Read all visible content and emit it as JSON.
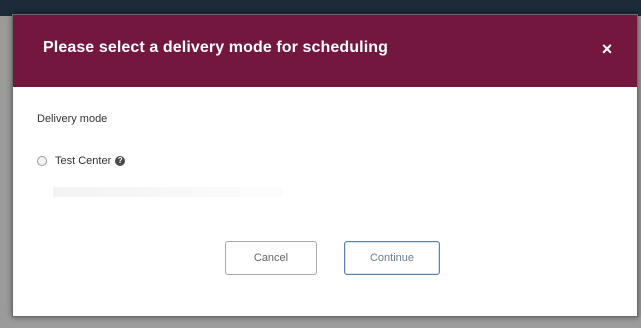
{
  "dialog": {
    "title": "Please select a delivery mode for scheduling",
    "close_label": "×"
  },
  "form": {
    "field_label": "Delivery mode",
    "options": [
      {
        "label": "Test Center",
        "selected": false,
        "help_icon": "question-circle-icon"
      }
    ],
    "help_glyph": "?"
  },
  "buttons": {
    "cancel_label": "Cancel",
    "continue_label": "Continue"
  },
  "colors": {
    "header_background": "#74173f",
    "header_text": "#ffffff",
    "continue_border": "#5e7fa8"
  }
}
